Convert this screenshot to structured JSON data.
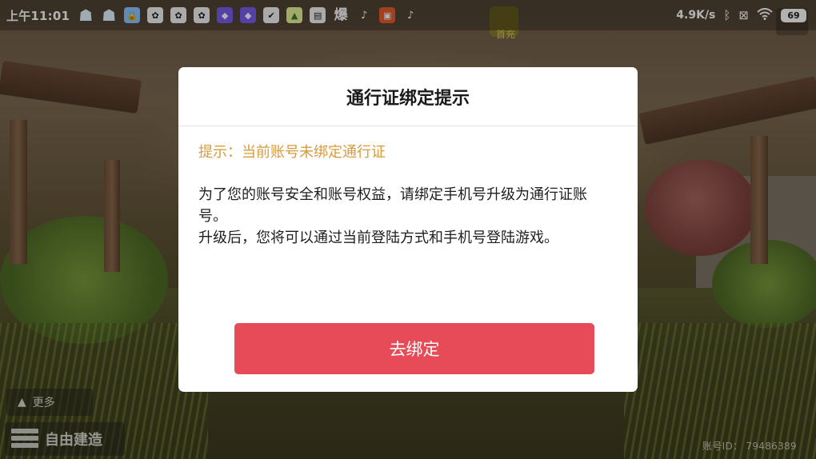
{
  "status_bar": {
    "time": "上午11:01",
    "notification_icons": [
      {
        "name": "qq-icon",
        "glyph": "☗"
      },
      {
        "name": "qq-icon",
        "glyph": "☗"
      },
      {
        "name": "lock-app-icon",
        "glyph": "🔒"
      },
      {
        "name": "game-app-icon",
        "glyph": "✿"
      },
      {
        "name": "game-app-icon",
        "glyph": "✿"
      },
      {
        "name": "game-app-icon",
        "glyph": "✿"
      },
      {
        "name": "shield-app-icon",
        "glyph": "◆"
      },
      {
        "name": "shield-app-icon",
        "glyph": "◆"
      },
      {
        "name": "check-app-icon",
        "glyph": "✔"
      },
      {
        "name": "lime-app-icon",
        "glyph": "▲"
      },
      {
        "name": "bili-app-icon",
        "glyph": "▤"
      },
      {
        "name": "news-app-icon",
        "glyph": "爆"
      },
      {
        "name": "tiktok-icon",
        "glyph": "♪"
      },
      {
        "name": "orange-app-icon",
        "glyph": "▣"
      },
      {
        "name": "tiktok-icon",
        "glyph": "♪"
      }
    ],
    "net_speed": "4.9K/s",
    "battery_level": "69"
  },
  "game_ui": {
    "top_label": "首充",
    "more_label": "更多",
    "build_label": "自由建造",
    "account_id": "账号ID： 79486389"
  },
  "dialog": {
    "title": "通行证绑定提示",
    "hint": "提示：当前账号未绑定通行证",
    "body_line1": "为了您的账号安全和账号权益，请绑定手机号升级为通行证账号。",
    "body_line2": "升级后，您将可以通过当前登陆方式和手机号登陆游戏。",
    "bind_button": "去绑定"
  },
  "colors": {
    "hint": "#d99a3a",
    "button": "#e64b57"
  }
}
